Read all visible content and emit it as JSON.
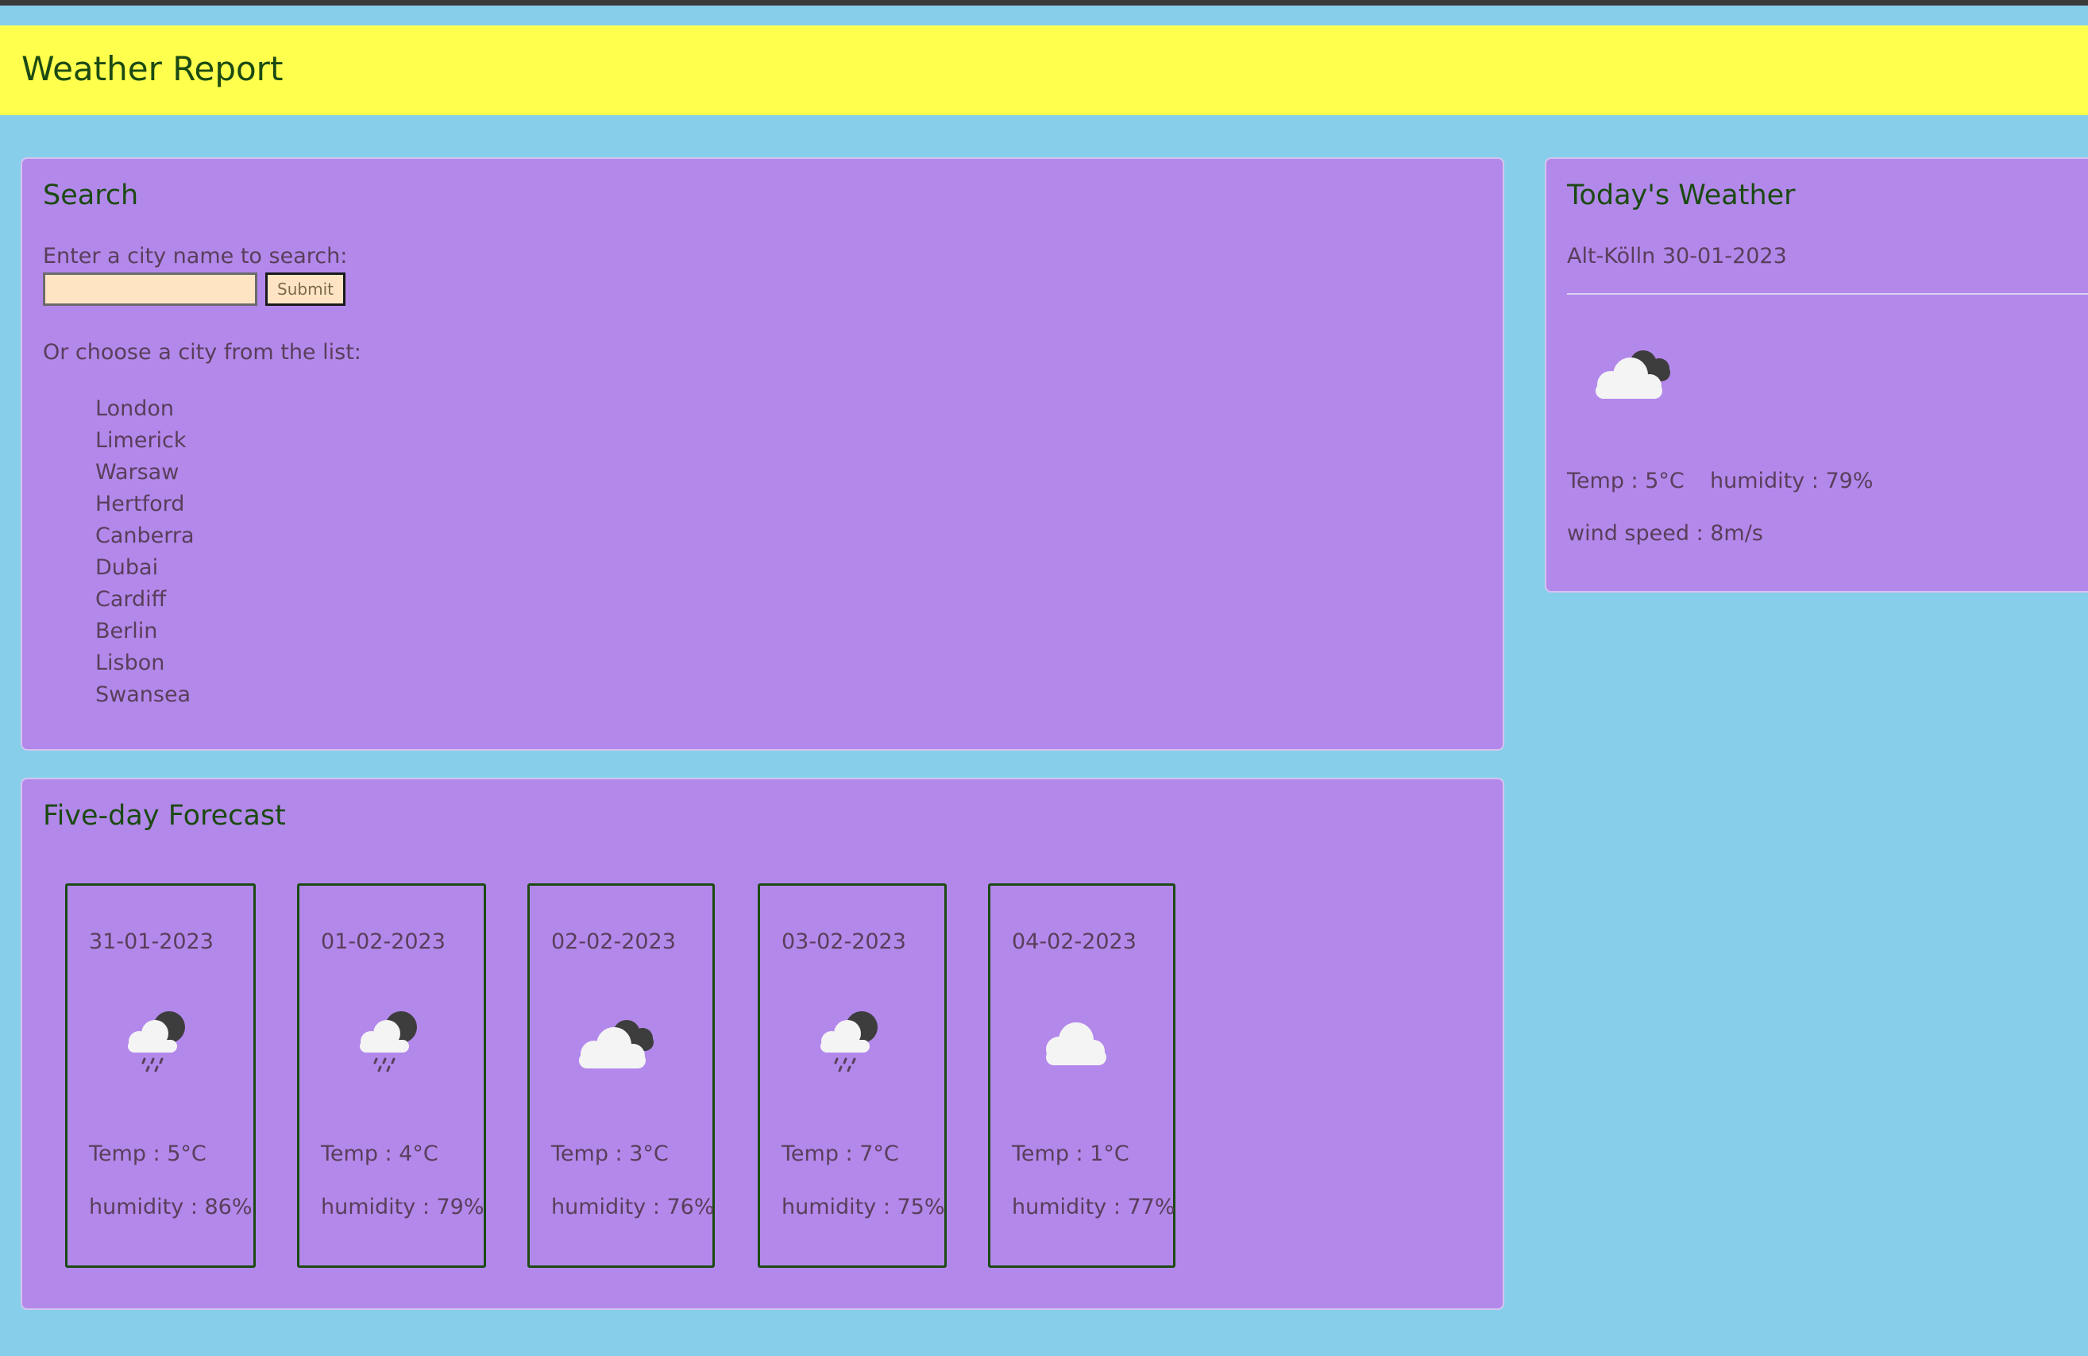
{
  "header": {
    "title": "Weather Report"
  },
  "search": {
    "title": "Search",
    "prompt": "Enter a city name to search:",
    "input_value": "",
    "submit_label": "Submit",
    "list_prompt": "Or choose a city from the list:",
    "cities": [
      "London",
      "Limerick",
      "Warsaw",
      "Hertford",
      "Canberra",
      "Dubai",
      "Cardiff",
      "Berlin",
      "Lisbon",
      "Swansea"
    ]
  },
  "today": {
    "title": "Today's Weather",
    "location_date": "Alt-Kölln 30-01-2023",
    "icon": "cloud-dark-clouds-icon",
    "temp": "Temp : 5°C",
    "humidity": "humidity : 79%",
    "wind": "wind speed : 8m/s"
  },
  "forecast": {
    "title": "Five-day Forecast",
    "days": [
      {
        "date": "31-01-2023",
        "icon": "cloud-moon-rain-icon",
        "temp": "Temp : 5°C",
        "humidity": "humidity : 86%"
      },
      {
        "date": "01-02-2023",
        "icon": "cloud-moon-rain-icon",
        "temp": "Temp : 4°C",
        "humidity": "humidity : 79%"
      },
      {
        "date": "02-02-2023",
        "icon": "cloud-dark-clouds-icon",
        "temp": "Temp : 3°C",
        "humidity": "humidity : 76%"
      },
      {
        "date": "03-02-2023",
        "icon": "cloud-moon-rain-icon",
        "temp": "Temp : 7°C",
        "humidity": "humidity : 75%"
      },
      {
        "date": "04-02-2023",
        "icon": "cloud-icon",
        "temp": "Temp : 1°C",
        "humidity": "humidity : 77%"
      }
    ]
  },
  "colors": {
    "background": "#87ceeb",
    "header": "#ffff4d",
    "panel": "#b388eb",
    "heading_text": "#1b4a12",
    "body_text": "#5a3e5a",
    "input_bg": "#ffe4c4"
  }
}
